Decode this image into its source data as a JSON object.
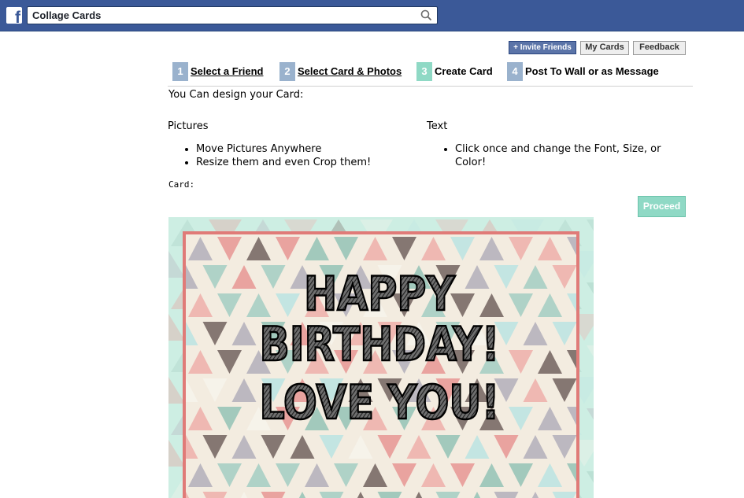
{
  "topbar": {
    "logo_letter": "f",
    "search_value": "Collage Cards",
    "search_placeholder": "Search"
  },
  "actions": {
    "invite_label": "+ Invite Friends",
    "my_cards_label": "My Cards",
    "feedback_label": "Feedback"
  },
  "steps": [
    {
      "num": "1",
      "label": "Select a Friend",
      "color": "#9ab2cd"
    },
    {
      "num": "2",
      "label": "Select Card & Photos",
      "color": "#9ab2cd"
    },
    {
      "num": "3",
      "label": "Create Card",
      "color": "#8fd9c5"
    },
    {
      "num": "4",
      "label": "Post To Wall or as Message",
      "color": "#9ab2cd"
    }
  ],
  "intro": "You Can design your Card:",
  "pictures": {
    "heading": "Pictures",
    "items": [
      "Move Pictures Anywhere",
      "Resize them and even Crop them!"
    ]
  },
  "text_section": {
    "heading": "Text",
    "items": [
      "Click once and change the Font, Size, or Color!"
    ]
  },
  "card_label": "Card:",
  "proceed_label": "Proceed",
  "card": {
    "lines": [
      "HAPPY",
      "BIRTHDAY!",
      "LOVE YOU!"
    ],
    "border_color": "#e07b78",
    "background_color": "#cdeee3"
  },
  "colors": {
    "facebook_blue": "#3b5998",
    "step_inactive": "#9ab2cd",
    "step_active": "#8fd9c5"
  }
}
